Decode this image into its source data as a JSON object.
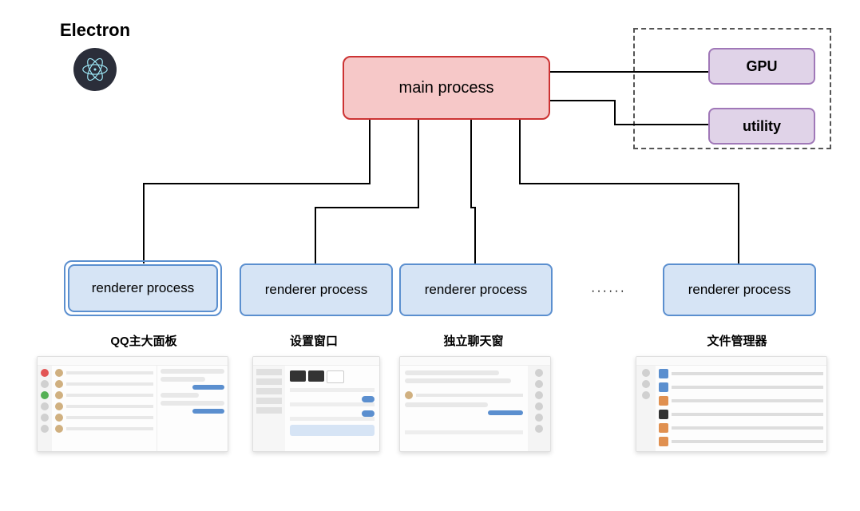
{
  "title": "Electron",
  "main_process": "main process",
  "gpu": "GPU",
  "utility": "utility",
  "renderers": [
    {
      "label": "renderer process",
      "caption": "QQ主大面板"
    },
    {
      "label": "renderer process",
      "caption": "设置窗口"
    },
    {
      "label": "renderer process",
      "caption": "独立聊天窗"
    },
    {
      "label": "renderer process",
      "caption": "文件管理器"
    }
  ],
  "ellipsis": "······"
}
